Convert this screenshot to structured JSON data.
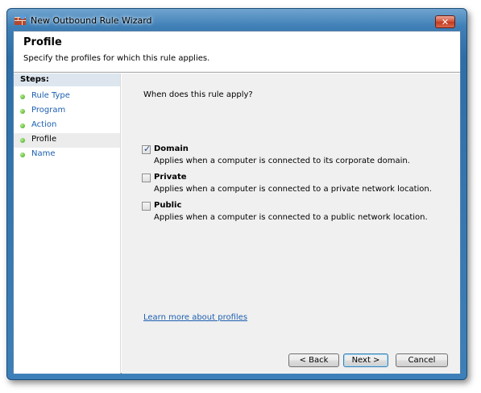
{
  "window": {
    "title": "New Outbound Rule Wizard",
    "close_glyph": "✕"
  },
  "header": {
    "title": "Profile",
    "subtitle": "Specify the profiles for which this rule applies."
  },
  "steps": {
    "title": "Steps:",
    "items": [
      {
        "label": "Rule Type",
        "state": "completed"
      },
      {
        "label": "Program",
        "state": "completed"
      },
      {
        "label": "Action",
        "state": "completed"
      },
      {
        "label": "Profile",
        "state": "current"
      },
      {
        "label": "Name",
        "state": "pending"
      }
    ]
  },
  "content": {
    "question": "When does this rule apply?",
    "options": [
      {
        "label": "Domain",
        "description": "Applies when a computer is connected to its corporate domain.",
        "checked": true
      },
      {
        "label": "Private",
        "description": "Applies when a computer is connected to a private network location.",
        "checked": false
      },
      {
        "label": "Public",
        "description": "Applies when a computer is connected to a public network location.",
        "checked": false
      }
    ],
    "learn_more": "Learn more about profiles"
  },
  "buttons": {
    "back": "< Back",
    "next": "Next >",
    "cancel": "Cancel"
  },
  "colors": {
    "link": "#1c5fb0",
    "step_dot": "#3ea01c",
    "title_bar": "#3f7fb6"
  }
}
